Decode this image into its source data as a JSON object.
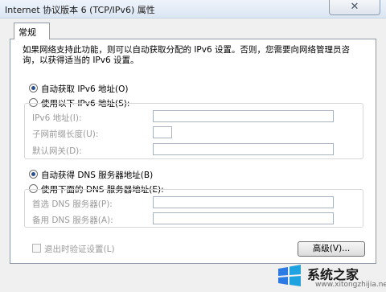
{
  "window": {
    "title": "Internet 协议版本 6 (TCP/IPv6) 属性",
    "close_label": "✕"
  },
  "tabs": [
    {
      "label": "常规"
    }
  ],
  "intro": {
    "line1": "如果网络支持此功能，则可以自动获取分配的 IPv6 设置。否则，您需要向网络管理员咨",
    "line2": "询，以获得适当的 IPv6 设置。"
  },
  "ip_section": {
    "auto_label": "自动获取 IPv6 地址(O)",
    "manual_label": "使用以下 IPv6 地址(S):",
    "auto_selected": true,
    "fields": [
      {
        "label": "IPv6 地址(I):",
        "value": ""
      },
      {
        "label": "子网前缀长度(U):",
        "value": ""
      },
      {
        "label": "默认网关(D):",
        "value": ""
      }
    ]
  },
  "dns_section": {
    "auto_label": "自动获得 DNS 服务器地址(B)",
    "manual_label": "使用下面的 DNS 服务器地址(E):",
    "auto_selected": true,
    "fields": [
      {
        "label": "首选 DNS 服务器(P):",
        "value": ""
      },
      {
        "label": "备用 DNS 服务器(A):",
        "value": ""
      }
    ]
  },
  "validate_on_exit": {
    "label": "退出时验证设置(L)",
    "checked": false
  },
  "advanced_button": "高级(V)...",
  "watermark": {
    "text": "系统之家",
    "url": "www.xitongzhijia.net"
  },
  "colors": {
    "radio_dot": "#2a4f8f",
    "panel_border": "#8e9aa8",
    "disabled_text": "#9a9a9a"
  }
}
